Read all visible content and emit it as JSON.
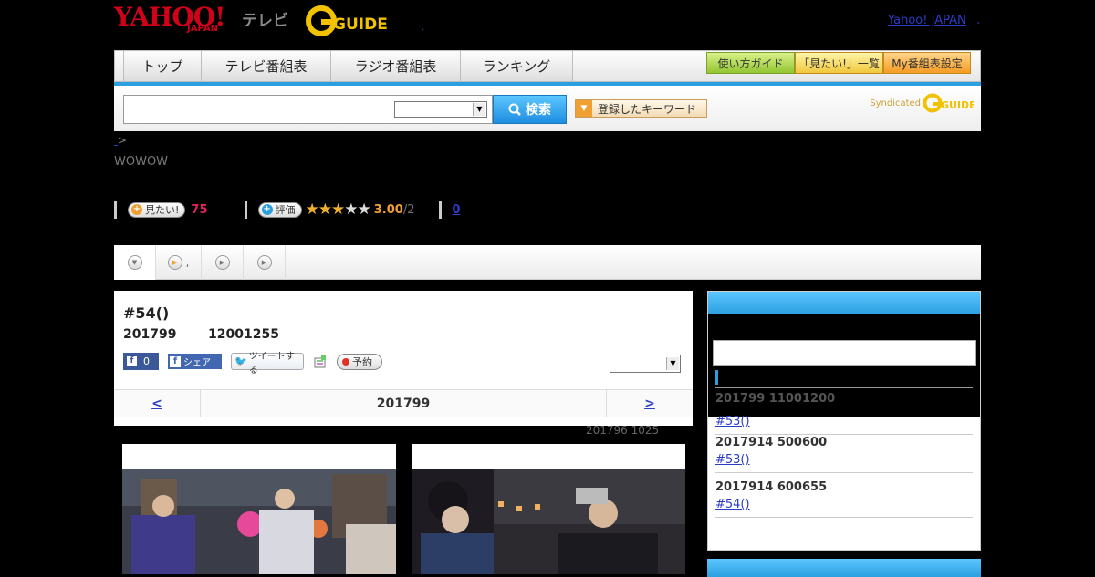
{
  "header": {
    "yahoo": "YAHOO!",
    "japan": "JAPAN",
    "tv": "テレビ",
    "gguide": "G-GUIDE",
    "comma": ",",
    "link": "Yahoo! JAPAN",
    "dot": "."
  },
  "nav": {
    "tabs": [
      "トップ",
      "テレビ番組表",
      "ラジオ番組表",
      "ランキング"
    ],
    "buttons": [
      "使い方ガイド",
      "「見たい!」一覧",
      "My番組表設定"
    ]
  },
  "search": {
    "button": "検索",
    "keyword_button": "登録したキーワード",
    "syndicated": "Syndicated"
  },
  "breadcrumb": ">",
  "channel": "WOWOW",
  "stats": {
    "want_label": "見たい!",
    "want_count": "75",
    "rate_label": "評価",
    "stars_filled": 3,
    "stars_total": 5,
    "rating": "3.00",
    "rating_max": "/2",
    "comments": "0"
  },
  "subtabs": [
    ",",
    "",
    ""
  ],
  "episode": {
    "title": "#54()",
    "date": "201799",
    "time": "12001255",
    "fb_like_count": "0",
    "fb_share": "シェア",
    "tweet": "ツイートする",
    "reserve": "予約",
    "pager_prev": "<",
    "pager_mid": "201799",
    "pager_next": ">",
    "updated": "201796  1025"
  },
  "sidebar": {
    "items": [
      {
        "date": "201799  11001200",
        "link": "#53()"
      },
      {
        "date": "2017914  500600",
        "link": "#53()"
      },
      {
        "date": "2017914  600655",
        "link": "#54()"
      }
    ]
  },
  "colors": {
    "accent_blue": "#2b9fe0",
    "want_pink": "#d9255c",
    "star_gold": "#f0b02c"
  }
}
